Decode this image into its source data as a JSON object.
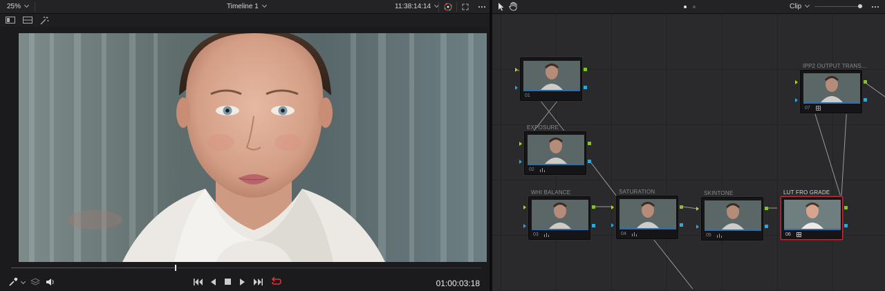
{
  "viewer": {
    "zoom": "25%",
    "timeline_name": "Timeline 1",
    "source_timecode": "11:38:14:14",
    "record_timecode": "01:00:03:18",
    "playhead_progress": 0.35
  },
  "node_graph": {
    "mode": "Clip",
    "nodes": [
      {
        "id": "01",
        "label": "",
        "tool": ""
      },
      {
        "id": "02",
        "label": "EXPOSURE",
        "tool": "scope"
      },
      {
        "id": "03",
        "label": "WHI BALANCE",
        "tool": "scope"
      },
      {
        "id": "04",
        "label": "SATURATION",
        "tool": "scope"
      },
      {
        "id": "05",
        "label": "SKINTONE",
        "tool": "scope"
      },
      {
        "id": "06",
        "label": "LUT FRO GRADE",
        "tool": "grid",
        "selected": true
      },
      {
        "id": "07",
        "label": "IPP2 OUTPUT TRANS...",
        "tool": "grid"
      }
    ]
  },
  "icons": {
    "viewer": [
      "chevron-down-icon",
      "color-wheel-icon",
      "expand-icon",
      "more-icon",
      "single-view-icon",
      "split-view-icon",
      "magic-wand-icon"
    ],
    "transport": [
      "eyedropper-icon",
      "layers-icon",
      "speaker-icon",
      "skip-back-icon",
      "play-reverse-icon",
      "stop-icon",
      "play-icon",
      "skip-forward-icon",
      "loop-icon"
    ],
    "graph": [
      "pointer-icon",
      "hand-icon"
    ]
  },
  "colors": {
    "selected_node": "#c2303a",
    "loop_active": "#e0323a",
    "pin_rgb_in": "#b7d71a",
    "pin_key": "#27a9e1",
    "pin_rgb_out": "#7ec81c"
  }
}
